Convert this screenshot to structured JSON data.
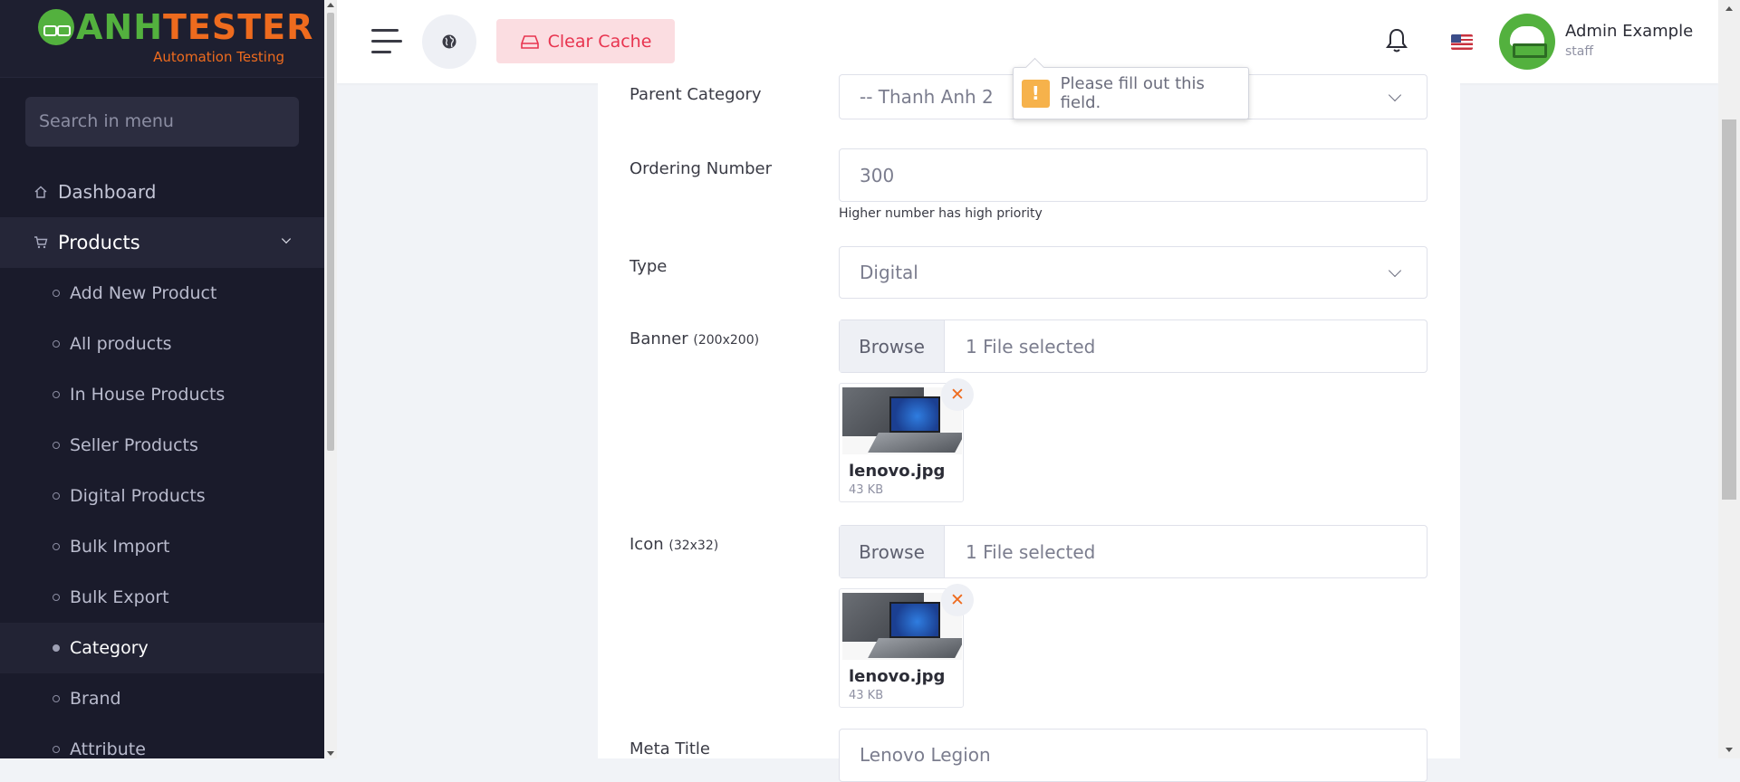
{
  "brand": {
    "name_part1": "ANH",
    "name_part2": "TESTER",
    "tagline": "Automation Testing"
  },
  "sidebar": {
    "search_placeholder": "Search in menu",
    "items": [
      {
        "label": "Dashboard",
        "icon": "home-icon"
      },
      {
        "label": "Products",
        "icon": "cart-icon",
        "expanded": true
      }
    ],
    "sub_items": [
      "Add New Product",
      "All products",
      "In House Products",
      "Seller Products",
      "Digital Products",
      "Bulk Import",
      "Bulk Export",
      "Category",
      "Brand",
      "Attribute"
    ],
    "active_sub_item": "Category"
  },
  "topbar": {
    "clear_cache_label": "Clear Cache",
    "user_name": "Admin Example",
    "user_role": "staff",
    "language_flag": "us-flag-icon"
  },
  "form": {
    "parent_category": {
      "label": "Parent Category",
      "value": "-- Thanh Anh 2"
    },
    "ordering_number": {
      "label": "Ordering Number",
      "value": "300",
      "hint": "Higher number has high priority"
    },
    "type": {
      "label": "Type",
      "value": "Digital"
    },
    "banner": {
      "label": "Banner",
      "size_note": "(200x200)",
      "browse_label": "Browse",
      "status": "1 File selected",
      "file_name": "lenovo.jpg",
      "file_size": "43 KB"
    },
    "icon": {
      "label": "Icon",
      "size_note": "(32x32)",
      "browse_label": "Browse",
      "status": "1 File selected",
      "file_name": "lenovo.jpg",
      "file_size": "43 KB"
    },
    "meta_title": {
      "label": "Meta Title",
      "value": "Lenovo Legion"
    }
  },
  "validation_tooltip": {
    "message": "Please fill out this field."
  },
  "colors": {
    "sidebar_bg": "#1a1b2b",
    "accent_orange": "#ee6b1e",
    "brand_green": "#53b13e",
    "danger": "#e8344f"
  }
}
